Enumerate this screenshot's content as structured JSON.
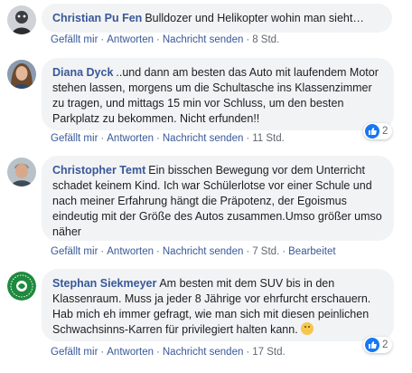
{
  "comments": [
    {
      "author": "Christian Pu Fen",
      "text": "Bulldozer und Helikopter wohin man sieht…",
      "actions": {
        "like": "Gefällt mir",
        "reply": "Antworten",
        "message": "Nachricht senden",
        "time": "8 Std."
      }
    },
    {
      "author": "Diana Dyck",
      "text": "..und dann am besten das Auto mit laufendem Motor stehen lassen, morgens um die Schultasche ins Klassenzimmer zu tragen, und mittags 15 min vor Schluss, um den besten Parkplatz zu bekommen. Nicht erfunden!!",
      "actions": {
        "like": "Gefällt mir",
        "reply": "Antworten",
        "message": "Nachricht senden",
        "time": "11 Std."
      },
      "reactions": {
        "icon": "thumbs-up-icon",
        "count": "2"
      }
    },
    {
      "author": "Christopher Temt",
      "text": "Ein bisschen Bewegung vor dem Unterricht schadet keinem Kind. Ich war Schülerlotse vor einer Schule und nach meiner Erfahrung hängt die Präpotenz, der Egoismus eindeutig mit der Größe des Autos zusammen.Umso größer umso näher",
      "actions": {
        "like": "Gefällt mir",
        "reply": "Antworten",
        "message": "Nachricht senden",
        "time": "7 Std.",
        "edited": "Bearbeitet"
      }
    },
    {
      "author": "Stephan Siekmeyer",
      "text": "Am besten mit dem SUV bis in den Klassenraum. Muss ja jeder 8 Jährige vor ehrfurcht erschauern. Hab mich eh immer gefragt, wie man sich mit diesen peinlichen Schwachsinns-Karren für privilegiert halten kann.",
      "emoji": "thinking-face-icon",
      "actions": {
        "like": "Gefällt mir",
        "reply": "Antworten",
        "message": "Nachricht senden",
        "time": "17 Std."
      },
      "reactions": {
        "icon": "thumbs-up-icon",
        "count": "2"
      }
    }
  ],
  "avatars": {
    "c0": "stylized-face-avatar",
    "c1": "woman-photo-avatar",
    "c2": "man-photo-avatar",
    "c3": "fridays-for-future-logo-avatar"
  },
  "colors": {
    "link": "#385898",
    "meta": "#606770",
    "bubble": "#f2f3f5",
    "like_blue": "#1877f2"
  }
}
